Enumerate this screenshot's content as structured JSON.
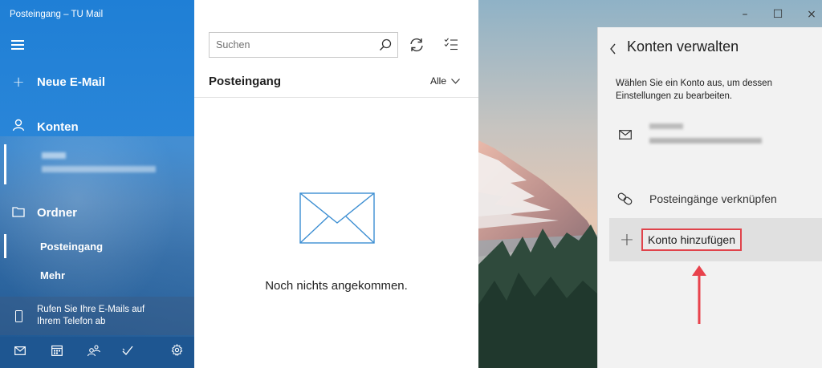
{
  "window": {
    "title": "Posteingang – TU Mail",
    "controls": {
      "minimize": "–",
      "maximize": "☐",
      "close": "×"
    }
  },
  "sidebar": {
    "new_mail": "Neue E-Mail",
    "accounts": "Konten",
    "folders": "Ordner",
    "folder_items": [
      "Posteingang",
      "Mehr"
    ],
    "phone_promo_line1": "Rufen Sie Ihre E-Mails auf",
    "phone_promo_line2": "Ihrem Telefon ab"
  },
  "list": {
    "search_placeholder": "Suchen",
    "folder_title": "Posteingang",
    "filter": "Alle",
    "empty_message": "Noch nichts angekommen."
  },
  "panel": {
    "title": "Konten verwalten",
    "description": "Wählen Sie ein Konto aus, um dessen Einstellungen zu bearbeiten.",
    "link_inboxes": "Posteingänge verknüpfen",
    "add_account": "Konto hinzufügen"
  },
  "colors": {
    "accent": "#0078d7",
    "highlight": "#e0434b",
    "arrow": "#e8424c"
  }
}
